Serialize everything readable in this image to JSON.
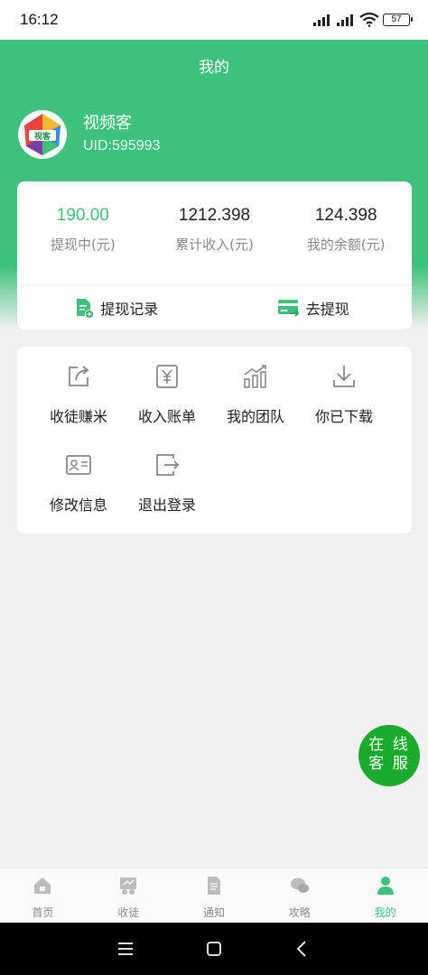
{
  "status": {
    "time": "16:12",
    "battery": "57"
  },
  "header": {
    "title": "我的"
  },
  "user": {
    "name": "视频客",
    "uid": "UID:595993",
    "avatar_text": "视客"
  },
  "stats": [
    {
      "value": "190.00",
      "label": "提现中(元)"
    },
    {
      "value": "1212.398",
      "label": "累计收入(元)"
    },
    {
      "value": "124.398",
      "label": "我的余额(元)"
    }
  ],
  "actions": {
    "withdraw_record": "提现记录",
    "withdraw": "去提现"
  },
  "menu": [
    {
      "label": "收徒赚米",
      "icon": "share-icon"
    },
    {
      "label": "收入账单",
      "icon": "yen-icon"
    },
    {
      "label": "我的团队",
      "icon": "bar-chart-icon"
    },
    {
      "label": "你已下载",
      "icon": "download-icon"
    },
    {
      "label": "修改信息",
      "icon": "id-card-icon"
    },
    {
      "label": "退出登录",
      "icon": "logout-icon"
    }
  ],
  "float_service": {
    "line1": "在 线",
    "line2": "客 服"
  },
  "tabs": [
    {
      "label": "首页",
      "icon": "home-icon"
    },
    {
      "label": "收徒",
      "icon": "apprentice-icon"
    },
    {
      "label": "通知",
      "icon": "document-icon"
    },
    {
      "label": "攻略",
      "icon": "chat-icon"
    },
    {
      "label": "我的",
      "icon": "person-icon"
    }
  ],
  "colors": {
    "accent": "#3ec17c",
    "service": "#1aab2d",
    "background": "#f0f0f0"
  }
}
